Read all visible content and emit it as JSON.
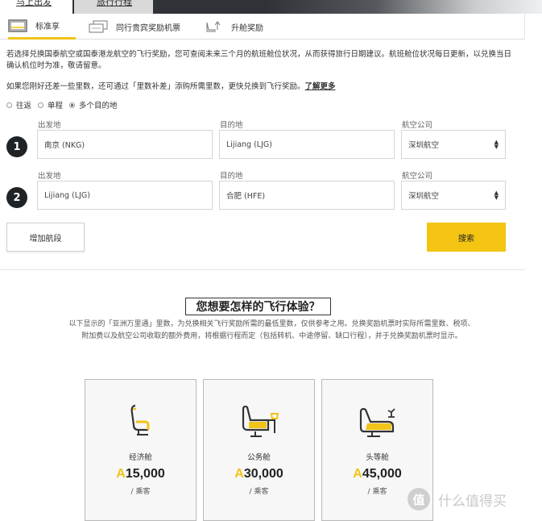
{
  "top_tabs": [
    "马上出发",
    "旅行行程"
  ],
  "sub_tabs": [
    {
      "label": "标准享",
      "icon": "window-icon",
      "active": true
    },
    {
      "label": "同行贵宾奖励机票",
      "icon": "two-tickets-icon",
      "active": false
    },
    {
      "label": "升舱奖励",
      "icon": "upgrade-seat-icon",
      "active": false
    }
  ],
  "info": {
    "paragraph": "若选择兑换国泰航空或国泰港龙航空的飞行奖励，您可查阅未来三个月的航班舱位状况，从而获得旅行日期建议。航班舱位状况每日更新，以兑换当日确认机位时为准，敬请留意。",
    "points_prefix": "如果您刚好还差一些里数，还可通过「里数补差」添购所需里数，更快兑换到飞行奖励。",
    "learn_more": "了解更多"
  },
  "trip_type": {
    "options": [
      "往返",
      "单程",
      "多个目的地"
    ],
    "selected": "多个目的地"
  },
  "labels": {
    "from": "出发地",
    "to": "目的地",
    "airline": "航空公司"
  },
  "segments": [
    {
      "num": "1",
      "from": "南京 (NKG)",
      "to": "Lijiang (LJG)",
      "airline": "深圳航空"
    },
    {
      "num": "2",
      "from": "Lijiang (LJG)",
      "to": "合肥 (HFE)",
      "airline": "深圳航空"
    }
  ],
  "buttons": {
    "add_segment": "增加航段",
    "search": "搜索"
  },
  "experience": {
    "title": "您想要怎样的飞行体验？",
    "description": "以下显示的「亚洲万里通」里数，为兑换相关飞行奖励所需的最低里数，仅供参考之用。兑换奖励机票时实际所需里数、税项、附加费以及航空公司收取的额外费用，将根据行程而定（包括转机、中途停留、缺口行程），并于兑换奖励机票时显示。",
    "cabins": [
      {
        "name": "经济舱",
        "symbol": "A",
        "points": "15,000",
        "per": "/ 乘客",
        "icon": "economy-seat-icon"
      },
      {
        "name": "公务舱",
        "symbol": "A",
        "points": "30,000",
        "per": "/ 乘客",
        "icon": "business-seat-icon"
      },
      {
        "name": "头等舱",
        "symbol": "A",
        "points": "45,000",
        "per": "/ 乘客",
        "icon": "first-seat-icon"
      }
    ]
  },
  "watermark": {
    "glyph": "值",
    "text": "什么值得买"
  },
  "colors": {
    "accent": "#f3c512",
    "dark": "#1f2326"
  }
}
